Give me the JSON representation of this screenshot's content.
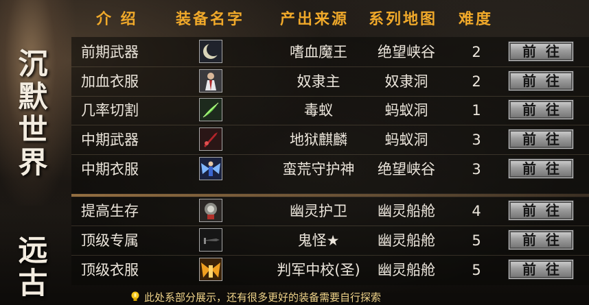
{
  "header": {
    "col_intro": "介 绍",
    "col_equip": "装备名字",
    "col_source": "产出来源",
    "col_map": "系列地图",
    "col_difficulty": "难度"
  },
  "side_titles": {
    "top": [
      "沉",
      "默",
      "世",
      "界"
    ],
    "bottom": [
      "远",
      "古"
    ]
  },
  "rows": [
    {
      "intro": "前期武器",
      "icon": "crescent-blade-icon",
      "source": "嗜血魔王",
      "map": "绝望峡谷",
      "difficulty": "2",
      "button": "前往"
    },
    {
      "intro": "加血衣服",
      "icon": "robed-figure-armor-icon",
      "source": "奴隶主",
      "map": "奴隶洞",
      "difficulty": "2",
      "button": "前往"
    },
    {
      "intro": "几率切割",
      "icon": "green-feather-icon",
      "source": "毒蚁",
      "map": "蚂蚁洞",
      "difficulty": "1",
      "button": "前往"
    },
    {
      "intro": "中期武器",
      "icon": "red-blade-icon",
      "source": "地狱麒麟",
      "map": "蚂蚁洞",
      "difficulty": "3",
      "button": "前往"
    },
    {
      "intro": "中期衣服",
      "icon": "winged-warrior-armor-icon",
      "source": "蛮荒守护神",
      "map": "绝望峡谷",
      "difficulty": "3",
      "button": "前往"
    },
    {
      "intro": "提高生存",
      "icon": "orb-shield-icon",
      "source": "幽灵护卫",
      "map": "幽灵船舱",
      "difficulty": "4",
      "button": "前往"
    },
    {
      "intro": "顶级专属",
      "icon": "dark-blade-icon",
      "source": "鬼怪★",
      "map": "幽灵船舱",
      "difficulty": "5",
      "button": "前往"
    },
    {
      "intro": "顶级衣服",
      "icon": "golden-wing-armor-icon",
      "source": "判军中校(圣)",
      "map": "幽灵船舱",
      "difficulty": "5",
      "button": "前往"
    }
  ],
  "footer": {
    "notice": "此处系部分展示，还有很多更好的装备需要自行探索",
    "icon": "lightbulb-icon"
  },
  "colors": {
    "header_text": "#f0a92a",
    "row_text": "#ece6dc",
    "footer_text": "#f0d48a"
  }
}
